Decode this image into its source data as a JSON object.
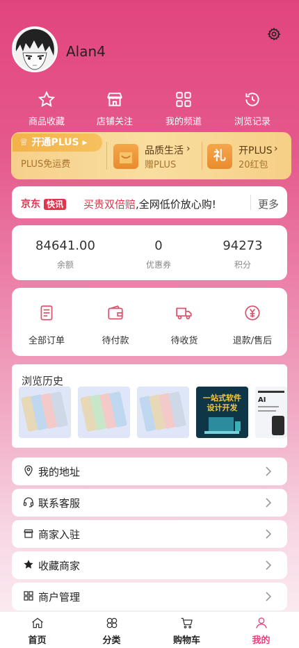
{
  "user": {
    "name": "Alan4"
  },
  "quick_links": [
    {
      "label": "商品收藏",
      "icon": "star-icon"
    },
    {
      "label": "店铺关注",
      "icon": "store-icon"
    },
    {
      "label": "我的频道",
      "icon": "grid-icon"
    },
    {
      "label": "浏览记录",
      "icon": "history-icon"
    }
  ],
  "plus_banner": {
    "badge": "开通PLUS",
    "sub": "PLUS免运费",
    "item1_title": "品质生活",
    "item1_sub": "赠PLUS",
    "item2_title": "开PLUS",
    "item2_sub": "20红包",
    "gift_char": "礼"
  },
  "news": {
    "logo_text": "京东",
    "logo_badge": "快讯",
    "highlight": "买贵双倍赔",
    "text": ",全网低价放心购!",
    "more": "更多"
  },
  "stats": [
    {
      "value": "84641.00",
      "label": "余额"
    },
    {
      "value": "0",
      "label": "优惠券"
    },
    {
      "value": "94273",
      "label": "积分"
    }
  ],
  "orders": [
    {
      "label": "全部订单",
      "icon": "clipboard-icon"
    },
    {
      "label": "待付款",
      "icon": "wallet-icon"
    },
    {
      "label": "待收货",
      "icon": "truck-icon"
    },
    {
      "label": "退款/售后",
      "icon": "refund-icon"
    }
  ],
  "history": {
    "title": "浏览历史",
    "thumb4_line1": "一站式软件",
    "thumb4_line2": "设计开发",
    "thumb5_text": "AI"
  },
  "menu": [
    {
      "label": "我的地址",
      "icon": "location-icon"
    },
    {
      "label": "联系客服",
      "icon": "headset-icon"
    },
    {
      "label": "商家入驻",
      "icon": "shop-icon"
    },
    {
      "label": "收藏商家",
      "icon": "star-filled-icon"
    },
    {
      "label": "商户管理",
      "icon": "apps-icon"
    }
  ],
  "tabs": [
    {
      "label": "首页",
      "icon": "home-icon"
    },
    {
      "label": "分类",
      "icon": "category-icon"
    },
    {
      "label": "购物车",
      "icon": "cart-icon"
    },
    {
      "label": "我的",
      "icon": "user-icon",
      "active": true
    }
  ],
  "colors": {
    "brand": "#e2457e",
    "news_highlight": "#e2344c",
    "gold": "#f6d08a"
  }
}
